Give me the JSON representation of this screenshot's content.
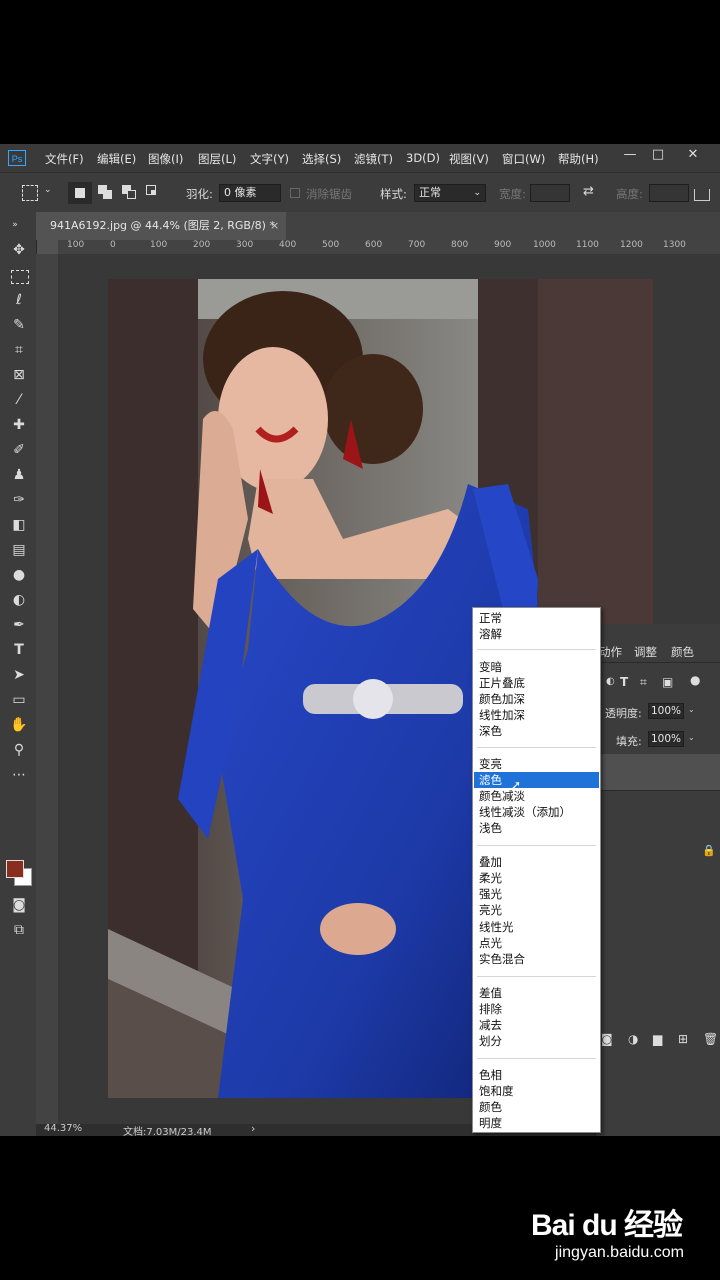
{
  "app": {
    "logo": "Ps"
  },
  "menu": [
    "文件(F)",
    "编辑(E)",
    "图像(I)",
    "图层(L)",
    "文字(Y)",
    "选择(S)",
    "滤镜(T)",
    "3D(D)",
    "视图(V)",
    "窗口(W)",
    "帮助(H)"
  ],
  "window_buttons": {
    "minimize": "—",
    "maximize": "□",
    "close": "✕"
  },
  "options": {
    "feather_label": "羽化:",
    "feather_value": "0 像素",
    "antialias_label": "消除锯齿",
    "style_label": "样式:",
    "style_value": "正常",
    "width_label": "宽度:",
    "height_label": "高度:"
  },
  "document_tab": {
    "title": "941A6192.jpg @ 44.4% (图层 2, RGB/8) *",
    "close": "×"
  },
  "ruler_labels": [
    "100",
    "0",
    "100",
    "200",
    "300",
    "400",
    "500",
    "600",
    "700",
    "800",
    "900",
    "1000",
    "1100",
    "1200",
    "1300"
  ],
  "status": {
    "zoom": "44.37%",
    "doc": "文档:7.03M/23.4M",
    "arrow": "›"
  },
  "panel": {
    "tabs": [
      "动作",
      "调整",
      "颜色"
    ],
    "opacity_label": "透明度:",
    "opacity_value": "100%",
    "fill_label": "填充:",
    "fill_value": "100%"
  },
  "blend_modes": {
    "groups": [
      [
        "正常",
        "溶解"
      ],
      [
        "变暗",
        "正片叠底",
        "颜色加深",
        "线性加深",
        "深色"
      ],
      [
        "变亮",
        "滤色",
        "颜色减淡",
        "线性减淡（添加）",
        "浅色"
      ],
      [
        "叠加",
        "柔光",
        "强光",
        "亮光",
        "线性光",
        "点光",
        "实色混合"
      ],
      [
        "差值",
        "排除",
        "减去",
        "划分"
      ],
      [
        "色相",
        "饱和度",
        "颜色",
        "明度"
      ]
    ],
    "selected": "滤色"
  },
  "colors": {
    "foreground": "#8a2c1e",
    "background": "#ffffff",
    "dress": "#1d3aa8",
    "highlight": "#1e72d8"
  },
  "watermark": {
    "brand": "Bai du 经验",
    "url": "jingyan.baidu.com"
  }
}
